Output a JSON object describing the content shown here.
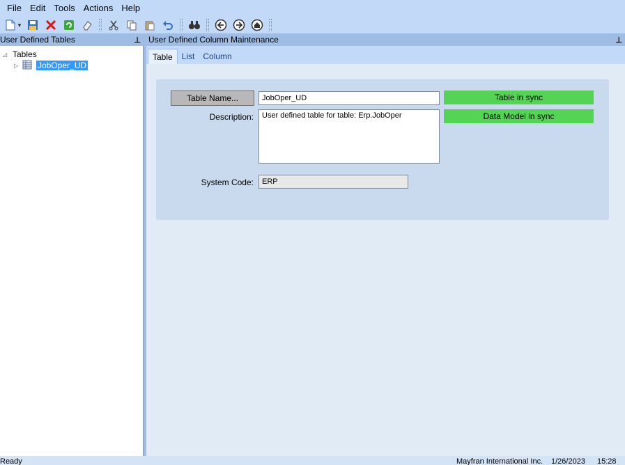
{
  "menu": [
    "File",
    "Edit",
    "Tools",
    "Actions",
    "Help"
  ],
  "toolbar": {
    "icons": [
      "new-icon",
      "save-icon",
      "delete-icon",
      "refresh-icon",
      "clear-icon",
      "cut-icon",
      "copy-icon",
      "paste-icon",
      "undo-icon",
      "search-icon",
      "back-icon",
      "forward-icon",
      "home-icon"
    ]
  },
  "left_panel": {
    "title": "User Defined Tables",
    "tree": {
      "root": "Tables",
      "child": "JobOper_UD"
    }
  },
  "right_panel": {
    "title": "User Defined Column Maintenance",
    "tabs": [
      "Table",
      "List",
      "Column"
    ],
    "active_tab": "Table"
  },
  "form": {
    "table_name_button": "Table Name...",
    "table_name_value": "JobOper_UD",
    "description_label": "Description:",
    "description_value": "User defined table for table: Erp.JobOper",
    "system_code_label": "System Code:",
    "system_code_value": "ERP",
    "status_table": "Table in sync",
    "status_model": "Data Model in sync",
    "status_color": "#55d355"
  },
  "statusbar": {
    "state": "Ready",
    "company": "Mayfran International Inc.",
    "date": "1/26/2023",
    "time": "15:28"
  }
}
